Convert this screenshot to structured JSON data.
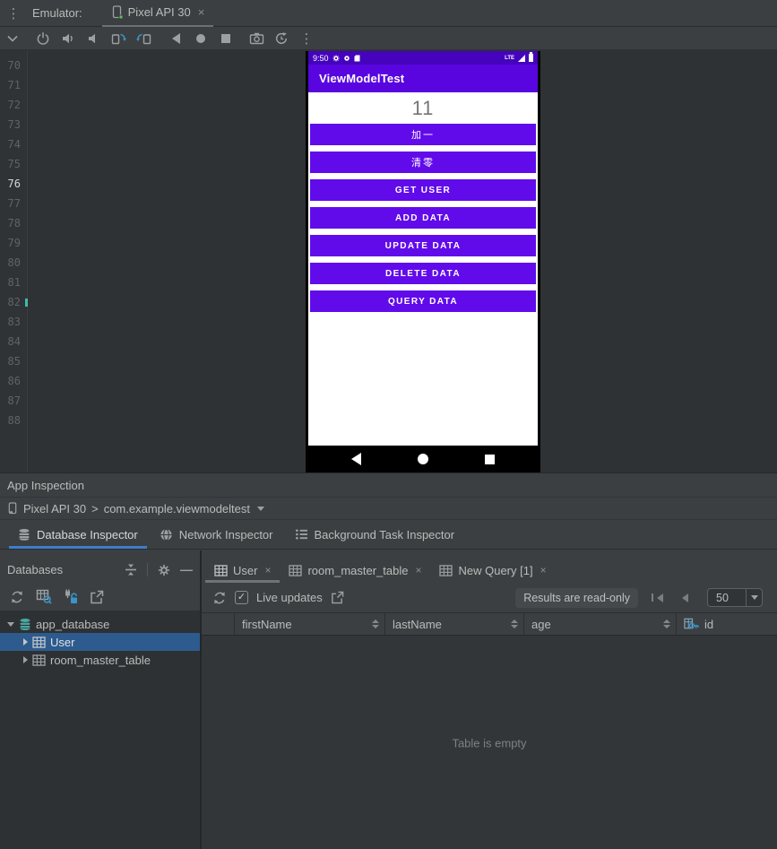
{
  "glyphs": {
    "kebab": "⋮",
    "close": "×",
    "check": "✓"
  },
  "window": {
    "emulator_label": "Emulator:",
    "device_tab_title": "Pixel API 30"
  },
  "gutter": {
    "lines": [
      "70",
      "71",
      "72",
      "73",
      "74",
      "75",
      "76",
      "77",
      "78",
      "79",
      "80",
      "81",
      "82",
      "83",
      "84",
      "85",
      "86",
      "87",
      "88"
    ],
    "active_line": "76"
  },
  "device": {
    "status": {
      "time": "9:50",
      "network": "LTE"
    },
    "app_title": "ViewModelTest",
    "counter": "11",
    "buttons": [
      "加一",
      "清零",
      "GET USER",
      "ADD DATA",
      "UPDATE DATA",
      "DELETE DATA",
      "QUERY DATA"
    ]
  },
  "inspection": {
    "panel_title": "App Inspection",
    "process": {
      "device": "Pixel API 30",
      "separator": ">",
      "package": "com.example.viewmodeltest"
    },
    "tabs": [
      "Database Inspector",
      "Network Inspector",
      "Background Task Inspector"
    ],
    "databases": {
      "title": "Databases",
      "tree": {
        "root": "app_database",
        "child0": "User",
        "child1": "room_master_table"
      }
    },
    "table": {
      "tabs": [
        "User",
        "room_master_table",
        "New Query [1]"
      ],
      "live_updates_label": "Live updates",
      "readonly_label": "Results are read-only",
      "page_size": "50",
      "columns": [
        "firstName",
        "lastName",
        "age",
        "id"
      ],
      "empty_text": "Table is empty"
    }
  },
  "colors": {
    "accent_blue": "#3d7dcc",
    "purple_appbar": "#5905df",
    "purple_status": "#4503bd",
    "purple_button": "#610bea",
    "selection_blue": "#2d5b8e",
    "icon_cyan": "#3995c9",
    "db_teal": "#4aa6a0"
  }
}
